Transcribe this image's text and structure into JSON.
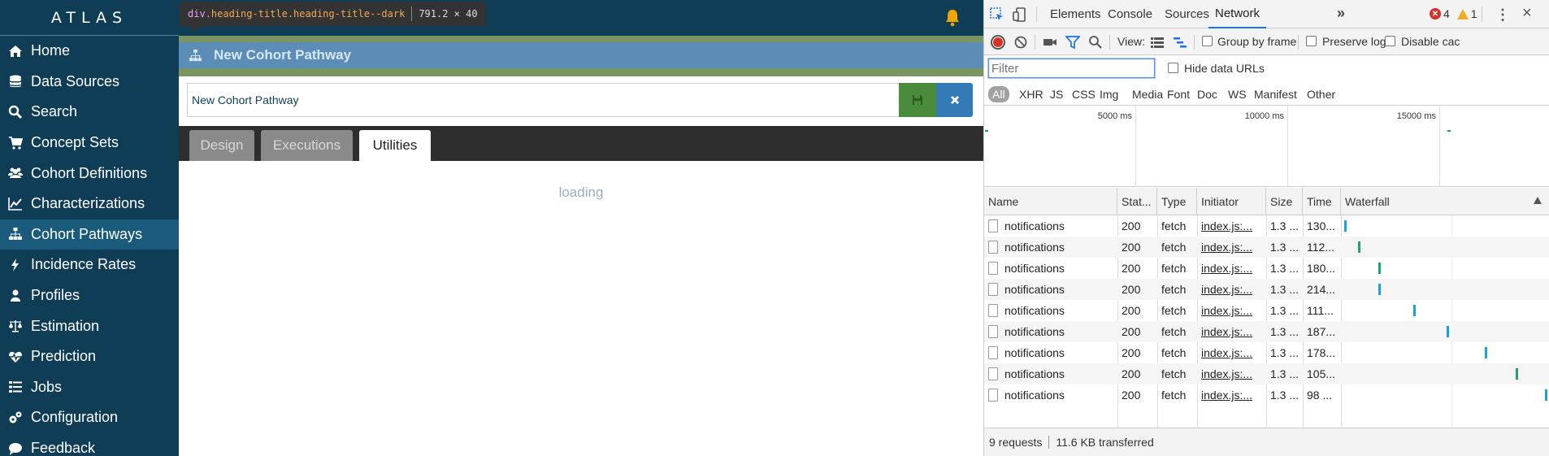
{
  "sidebar": {
    "brand": "ATLAS",
    "items": [
      {
        "label": "Home",
        "icon": "home-icon"
      },
      {
        "label": "Data Sources",
        "icon": "database-icon"
      },
      {
        "label": "Search",
        "icon": "search-icon"
      },
      {
        "label": "Concept Sets",
        "icon": "shopping-cart-icon"
      },
      {
        "label": "Cohort Definitions",
        "icon": "users-icon"
      },
      {
        "label": "Characterizations",
        "icon": "line-chart-icon"
      },
      {
        "label": "Cohort Pathways",
        "icon": "sitemap-icon",
        "active": true
      },
      {
        "label": "Incidence Rates",
        "icon": "bolt-icon"
      },
      {
        "label": "Profiles",
        "icon": "user-icon"
      },
      {
        "label": "Estimation",
        "icon": "balance-scale-icon"
      },
      {
        "label": "Prediction",
        "icon": "heartbeat-icon"
      },
      {
        "label": "Jobs",
        "icon": "tasks-icon"
      },
      {
        "label": "Configuration",
        "icon": "cogs-icon"
      },
      {
        "label": "Feedback",
        "icon": "comment-icon"
      }
    ]
  },
  "inspector_tooltip": {
    "tag": "div",
    "classes": ".heading-title.heading-title--dark",
    "size": "791.2 × 40"
  },
  "heading": {
    "title": "New Cohort Pathway",
    "icon": "sitemap-icon"
  },
  "name_field": {
    "value": "New Cohort Pathway"
  },
  "tabs": [
    {
      "label": "Design",
      "active": false
    },
    {
      "label": "Executions",
      "active": false
    },
    {
      "label": "Utilities",
      "active": true
    }
  ],
  "loading_text": "loading",
  "colors": {
    "sidebar_bg": "#0f3d55",
    "active_nav": "#1a5a7a",
    "heading_band": "#7b9562",
    "heading_title_bg": "#5c8db6",
    "save_green": "#4b8c3c",
    "close_blue": "#337ab7",
    "bell": "#f0a500",
    "waterfall_blue": "#1aa3d9",
    "waterfall_green": "#1aa37a"
  },
  "devtools": {
    "tabs": [
      {
        "label": "Elements",
        "active": false
      },
      {
        "label": "Console",
        "active": false
      },
      {
        "label": "Sources",
        "active": false
      },
      {
        "label": "Network",
        "active": true
      }
    ],
    "more_label": "»",
    "errors": "4",
    "warnings": "1",
    "view_label": "View:",
    "group_by_frame": "Group by frame",
    "preserve_log": "Preserve log",
    "disable_cache": "Disable cac",
    "filter_placeholder": "Filter",
    "hide_data_urls": "Hide data URLs",
    "type_filters": [
      "All",
      "XHR",
      "JS",
      "CSS",
      "Img",
      "Media",
      "Font",
      "Doc",
      "WS",
      "Manifest",
      "Other"
    ],
    "overview_labels": [
      "5000 ms",
      "10000 ms",
      "15000 ms"
    ],
    "columns": [
      "Name",
      "Stat...",
      "Type",
      "Initiator",
      "Size",
      "Time",
      "Waterfall"
    ],
    "rows": [
      {
        "name": "notifications",
        "status": "200",
        "type": "fetch",
        "initiator": "index.js:...",
        "size": "1.3 ...",
        "time": "130...",
        "wf": 0.01,
        "color": "blue"
      },
      {
        "name": "notifications",
        "status": "200",
        "type": "fetch",
        "initiator": "index.js:...",
        "size": "1.3 ...",
        "time": "112...",
        "wf": 0.08,
        "color": "green"
      },
      {
        "name": "notifications",
        "status": "200",
        "type": "fetch",
        "initiator": "index.js:...",
        "size": "1.3 ...",
        "time": "180...",
        "wf": 0.18,
        "color": "green"
      },
      {
        "name": "notifications",
        "status": "200",
        "type": "fetch",
        "initiator": "index.js:...",
        "size": "1.3 ...",
        "time": "214...",
        "wf": 0.18,
        "color": "blue"
      },
      {
        "name": "notifications",
        "status": "200",
        "type": "fetch",
        "initiator": "index.js:...",
        "size": "1.3 ...",
        "time": "111...",
        "wf": 0.35,
        "color": "blue"
      },
      {
        "name": "notifications",
        "status": "200",
        "type": "fetch",
        "initiator": "index.js:...",
        "size": "1.3 ...",
        "time": "187...",
        "wf": 0.51,
        "color": "blue"
      },
      {
        "name": "notifications",
        "status": "200",
        "type": "fetch",
        "initiator": "index.js:...",
        "size": "1.3 ...",
        "time": "178...",
        "wf": 0.7,
        "color": "blue"
      },
      {
        "name": "notifications",
        "status": "200",
        "type": "fetch",
        "initiator": "index.js:...",
        "size": "1.3 ...",
        "time": "105...",
        "wf": 0.85,
        "color": "green"
      },
      {
        "name": "notifications",
        "status": "200",
        "type": "fetch",
        "initiator": "index.js:...",
        "size": "1.3 ...",
        "time": "98 ...",
        "wf": 0.99,
        "color": "blue"
      }
    ],
    "status_requests": "9 requests",
    "status_transferred": "11.6 KB transferred"
  }
}
